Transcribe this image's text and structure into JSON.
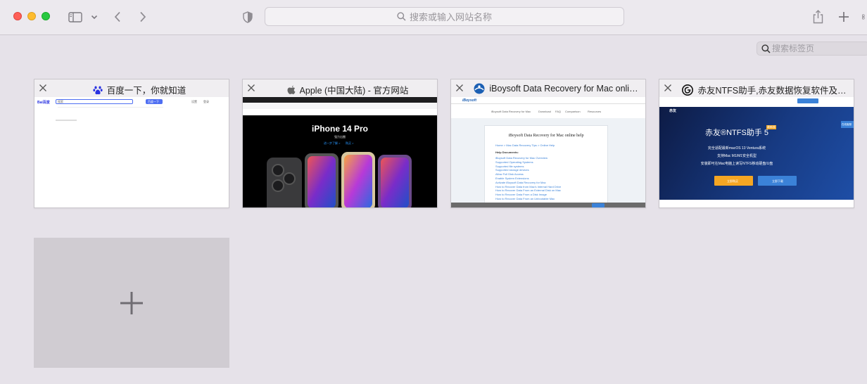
{
  "toolbar": {
    "address_placeholder": "搜索或输入网站名称"
  },
  "tab_search": {
    "placeholder": "搜索标签页"
  },
  "tabs": [
    {
      "title": "百度一下，你就知道",
      "favicon": "baidu-paw-icon",
      "preview": {
        "logo": "Bai百度",
        "search_value": "搜索",
        "search_button": "百度一下",
        "nav": [
          "设置",
          "登录"
        ]
      }
    },
    {
      "title": "Apple (中国大陆) - 官方网站",
      "favicon": "apple-logo-icon",
      "preview": {
        "headline": "iPhone 14 Pro",
        "subline": "强力出圈",
        "links": [
          "进一步了解 >",
          "购买 >"
        ]
      }
    },
    {
      "title": "iBoysoft Data Recovery for Mac onli…",
      "favicon": "iboysoft-icon",
      "preview": {
        "brand": "iBoysoft",
        "nav": [
          "iBoysoft Data Recovery for Mac",
          "Download",
          "FAQ",
          "Comparison",
          "Resources"
        ],
        "heading": "iBoysoft Data Recovery for Mac online help",
        "crumbs": "Home > Mac Data Recovery Tips > Online Help",
        "section": "Help Documents:",
        "links": [
          "iBoysoft Data Recovery for Mac Overview",
          "Supported Operating Systems",
          "Supported file systems",
          "Supported storage devices",
          "Allow Full Disk Access",
          "Enable System Extensions",
          "Activate iBoysoft Data Recovery for Mac",
          "How to Recover Data from Mac's Internal Hard Drive",
          "How to Recover Data From an External Disk on Mac",
          "How to Recover Data From a Disk Image",
          "How to Recover Data From an Unbootable Mac"
        ]
      }
    },
    {
      "title": "赤友NTFS助手,赤友数据恢复软件及…",
      "favicon": "chiyou-icon",
      "preview": {
        "brand": "赤友",
        "headline": "赤友®NTFS助手 5",
        "badge": "最新版",
        "lines": [
          "完全适配最新macOS 13 Ventura系统",
          "支持Mac M1/M1安全机型",
          "安装即可在Mac电脑上读写NTFS移动硬盘/U盘"
        ],
        "buttons": [
          "立即购买",
          "立即下载"
        ],
        "side_tag": "在线客服"
      }
    }
  ],
  "colors": {
    "accent": "#3b82d8",
    "baidu_blue": "#4e6ef2",
    "chiyou_orange": "#f5a623"
  }
}
